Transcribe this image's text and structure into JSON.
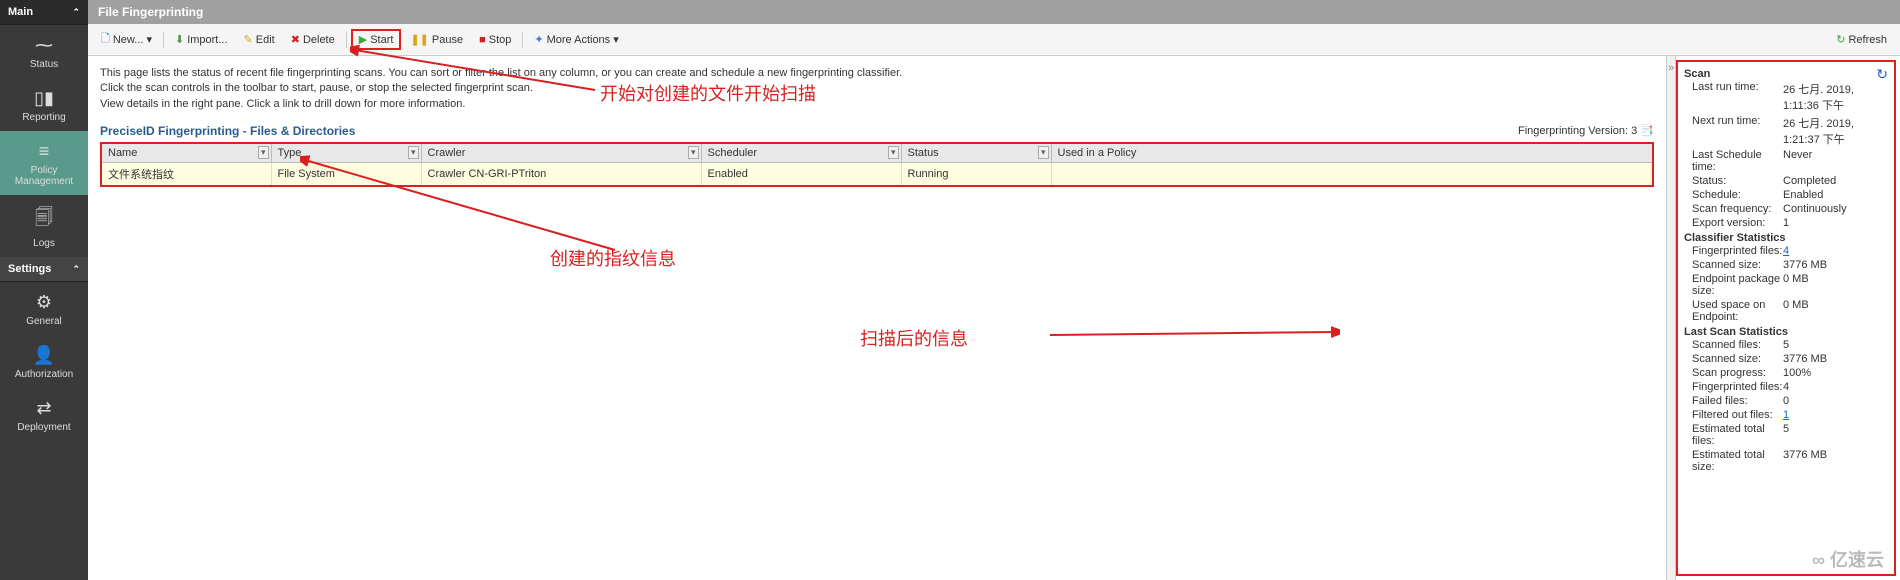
{
  "sidebar": {
    "main_header": "Main",
    "settings_header": "Settings",
    "items_main": [
      {
        "label": "Status",
        "icon": "⚡"
      },
      {
        "label": "Reporting",
        "icon": "📊"
      },
      {
        "label": "Policy Management",
        "icon": "📋"
      },
      {
        "label": "Logs",
        "icon": "📄"
      }
    ],
    "items_settings": [
      {
        "label": "General",
        "icon": "⚙"
      },
      {
        "label": "Authorization",
        "icon": "👤"
      },
      {
        "label": "Deployment",
        "icon": "🔀"
      }
    ]
  },
  "titlebar": "File Fingerprinting",
  "toolbar": {
    "new": "New...",
    "import": "Import...",
    "edit": "Edit",
    "delete": "Delete",
    "start": "Start",
    "pause": "Pause",
    "stop": "Stop",
    "more": "More Actions",
    "refresh": "Refresh"
  },
  "description": {
    "line1": "This page lists the status of recent file fingerprinting scans. You can sort or filter the list on any column, or you can create and schedule a new fingerprinting classifier.",
    "line2": "Click the scan controls in the toolbar to start, pause, or stop the selected fingerprint scan.",
    "line3": "View details in the right pane. Click a link to drill down for more information."
  },
  "section": {
    "title": "PreciseID Fingerprinting - Files & Directories",
    "version_label": "Fingerprinting Version:",
    "version_value": "3"
  },
  "table": {
    "headers": [
      "Name",
      "Type",
      "Crawler",
      "Scheduler",
      "Status",
      "Used in a Policy"
    ],
    "rows": [
      {
        "name": "文件系统指纹",
        "type": "File System",
        "crawler": "Crawler CN-GRI-PTriton",
        "scheduler": "Enabled",
        "status": "Running",
        "policy": ""
      }
    ]
  },
  "panel": {
    "scan_hdr": "Scan",
    "last_run_lbl": "Last run time:",
    "last_run_val": "26 七月. 2019, 1:11:36 下午",
    "next_run_lbl": "Next run time:",
    "next_run_val": "26 七月. 2019, 1:21:37 下午",
    "last_sched_lbl": "Last Schedule time:",
    "last_sched_val": "Never",
    "status_lbl": "Status:",
    "status_val": "Completed",
    "schedule_lbl": "Schedule:",
    "schedule_val": "Enabled",
    "freq_lbl": "Scan frequency:",
    "freq_val": "Continuously",
    "export_lbl": "Export version:",
    "export_val": "1",
    "cls_hdr": "Classifier Statistics",
    "fp_files_lbl": "Fingerprinted files:",
    "fp_files_val": "4",
    "scan_size_lbl": "Scanned size:",
    "scan_size_val": "3776 MB",
    "ep_pkg_lbl": "Endpoint package size:",
    "ep_pkg_val": "0 MB",
    "ep_used_lbl": "Used space on Endpoint:",
    "ep_used_val": "0 MB",
    "last_hdr": "Last Scan Statistics",
    "sf_lbl": "Scanned files:",
    "sf_val": "5",
    "ss_lbl": "Scanned size:",
    "ss_val": "3776 MB",
    "prog_lbl": "Scan progress:",
    "prog_val": "100%",
    "fpf_lbl": "Fingerprinted files:",
    "fpf_val": "4",
    "fail_lbl": "Failed files:",
    "fail_val": "0",
    "filt_lbl": "Filtered out files:",
    "filt_val": "1",
    "etf_lbl": "Estimated total files:",
    "etf_val": "5",
    "ets_lbl": "Estimated total size:",
    "ets_val": "3776 MB"
  },
  "annotations": {
    "a1": "开始对创建的文件开始扫描",
    "a2": "创建的指纹信息",
    "a3": "扫描后的信息"
  },
  "brand": "亿速云"
}
